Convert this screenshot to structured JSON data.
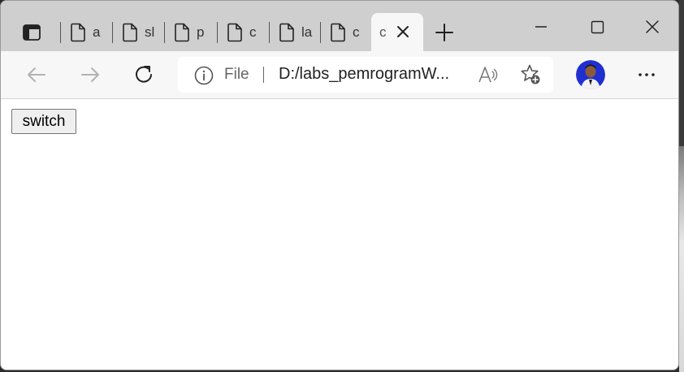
{
  "browser": {
    "tabs": [
      {
        "title": "a",
        "icon": "page-icon"
      },
      {
        "title": "sl",
        "icon": "page-icon"
      },
      {
        "title": "p",
        "icon": "page-icon"
      },
      {
        "title": "c",
        "icon": "page-icon"
      },
      {
        "title": "la",
        "icon": "page-icon"
      },
      {
        "title": "c",
        "icon": "page-icon"
      }
    ],
    "active_tab": {
      "title": "c"
    },
    "address": {
      "scheme_label": "File",
      "url": "D:/labs_pemrogramW..."
    },
    "colors": {
      "tabstrip": "#cfcfcf",
      "toolbar": "#f7f7f7",
      "profile_bg": "#1f2fd0"
    }
  },
  "page": {
    "switch_label": "switch"
  }
}
